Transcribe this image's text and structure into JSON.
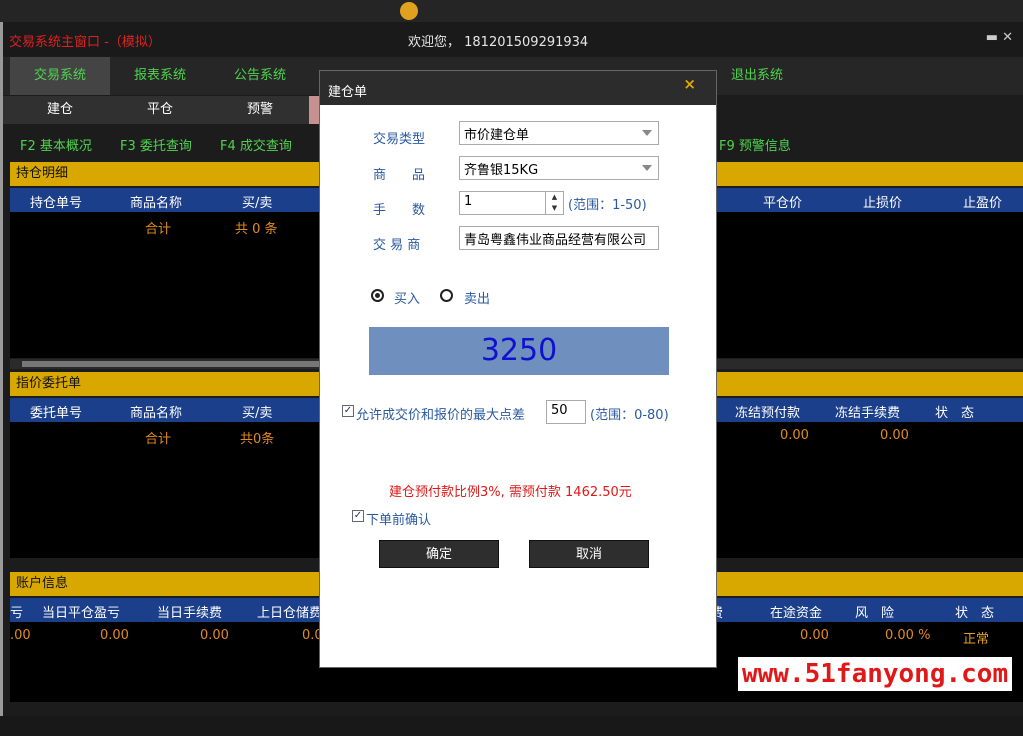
{
  "window": {
    "title": "交易系统主窗口 -（模拟）",
    "welcome": "欢迎您， 181201509291934"
  },
  "nav": {
    "tabs": [
      "交易系统",
      "报表系统",
      "公告系统",
      "退出系统"
    ]
  },
  "subnav": {
    "tabs": [
      "建仓",
      "平仓",
      "预警"
    ]
  },
  "fkeys": [
    "F2 基本概况",
    "F3 委托查询",
    "F4 成交查询",
    "F9 预警信息"
  ],
  "positions": {
    "title": "持仓明细",
    "headers_left": [
      "持仓单号",
      "商品名称",
      "买/卖"
    ],
    "headers_right": [
      "平仓价",
      "止损价",
      "止盈价"
    ],
    "total_label": "合计",
    "total_count": "共 0 条"
  },
  "limit_orders": {
    "title": "指价委托单",
    "headers_left": [
      "委托单号",
      "商品名称",
      "买/卖"
    ],
    "headers_right": [
      "冻结预付款",
      "冻结手续费",
      "状　态"
    ],
    "total_label": "合计",
    "total_count": "共0条",
    "frozen_prepay": "0.00",
    "frozen_fee": "0.00"
  },
  "account": {
    "title": "账户信息",
    "headers_left": [
      "亏",
      "当日平仓盈亏",
      "当日手续费",
      "上日仓储费"
    ],
    "headers_right": [
      "费",
      "在途资金",
      "风　险",
      "状　态"
    ],
    "values_left": [
      ".00",
      "0.00",
      "0.00",
      "0.0"
    ],
    "values_right": [
      "0.00",
      "0.00 %",
      "正常"
    ]
  },
  "dialog": {
    "title": "建仓单",
    "close": "×",
    "trade_type_label": "交易类型",
    "trade_type_value": "市价建仓单",
    "product_label": "商　　品",
    "product_value": "齐鲁银15KG",
    "qty_label": "手　　数",
    "qty_value": "1",
    "qty_hint": "(范围：1-50)",
    "broker_label": "交 易 商",
    "broker_value": "青岛粤鑫伟业商品经营有限公司",
    "buy_label": "买入",
    "sell_label": "卖出",
    "price": "3250",
    "slippage_label": "允许成交价和报价的最大点差",
    "slippage_value": "50",
    "slippage_hint": "(范围：0-80)",
    "prepay_note": "建仓预付款比例3%, 需预付款 1462.50元",
    "confirm_label": "下单前确认",
    "ok": "确定",
    "cancel": "取消"
  },
  "watermark": "www.51fanyong.com",
  "colors": {
    "nav_green": "#4fd34f",
    "section_yellow": "#d9a800",
    "header_blue": "#1b3f8a",
    "value_orange": "#e08a20",
    "price_bg": "#6f90be",
    "alert_red": "#e01818"
  }
}
